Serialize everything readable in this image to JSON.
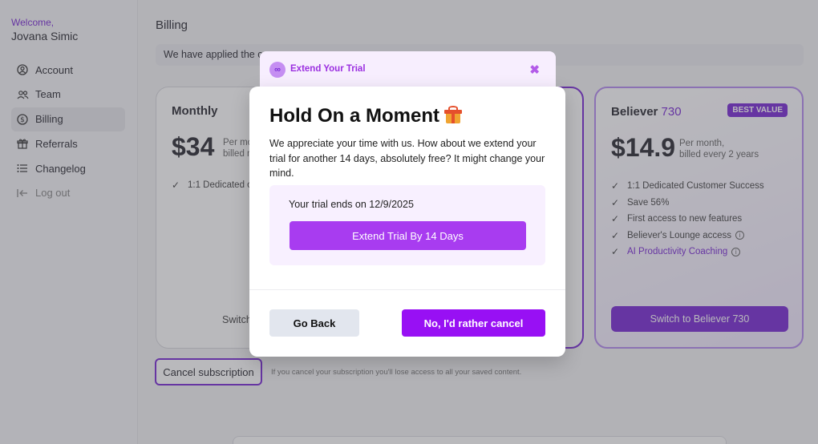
{
  "sidebar": {
    "welcome": "Welcome,",
    "username": "Jovana Simic",
    "items": [
      {
        "label": "Account",
        "icon": "user-circle-icon"
      },
      {
        "label": "Team",
        "icon": "team-icon"
      },
      {
        "label": "Billing",
        "icon": "dollar-icon",
        "active": true
      },
      {
        "label": "Referrals",
        "icon": "gift-icon"
      },
      {
        "label": "Changelog",
        "icon": "list-icon"
      },
      {
        "label": "Log out",
        "icon": "logout-icon"
      }
    ]
  },
  "main": {
    "title": "Billing",
    "coupon_prefix": "We have applied the co",
    "plans": {
      "monthly": {
        "name": "Monthly",
        "price": "$34",
        "price_sub_1": "Per mo",
        "price_sub_2": "billed m",
        "features": [
          "1:1 Dedicated or"
        ],
        "switch_label": "Switch"
      },
      "believer": {
        "name": "Believer",
        "name_num": "730",
        "badge": "BEST VALUE",
        "price": "$14.9",
        "price_sub_1": "Per month,",
        "price_sub_2": "billed every 2 years",
        "features": [
          "1:1 Dedicated Customer Success",
          "Save 56%",
          "First access to new features",
          "Believer's Lounge access",
          "AI Productivity Coaching"
        ],
        "switch_label": "Switch to Believer 730"
      }
    },
    "cancel_button": "Cancel subscription",
    "cancel_note": "If you cancel your subscription you'll lose access to all your saved content."
  },
  "modal": {
    "strip_title": "Extend Your Trial",
    "strip_logo": "∞",
    "title": "Hold On a Moment",
    "description": "We appreciate your time with us. How about we extend your trial for another 14 days, absolutely free? It might change your mind.",
    "trial_ends": "Your trial ends on 12/9/2025",
    "extend_label": "Extend Trial By 14 Days",
    "go_back_label": "Go Back",
    "cancel_label": "No, I'd rather cancel"
  },
  "colors": {
    "accent": "#7a2bd6",
    "modal_primary": "#9810f4",
    "extend_button": "#a83cf0"
  }
}
